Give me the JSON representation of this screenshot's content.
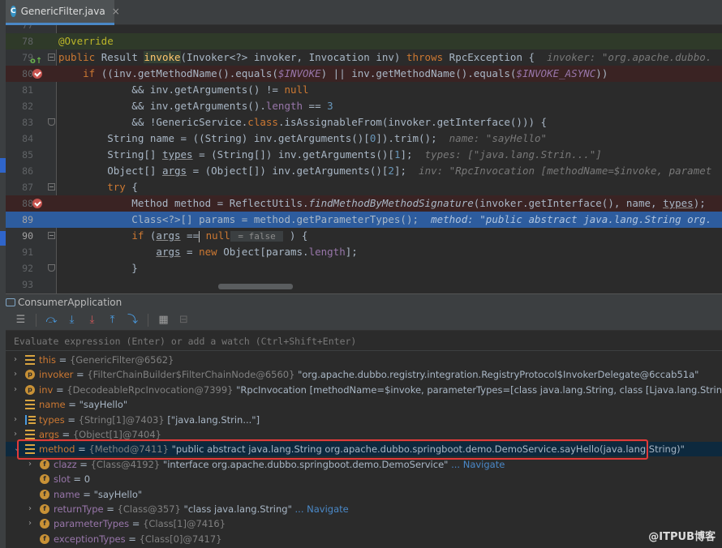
{
  "tab": {
    "icon_letter": "C",
    "label": "GenericFilter.java",
    "close": "×"
  },
  "editor": {
    "lines": [
      {
        "num": "77",
        "html": ""
      },
      {
        "num": "78",
        "html": "<span class='an'>@Override</span>"
      },
      {
        "num": "79",
        "html": "<span class='k'>public </span>Result <span class='fn hl'>invoke</span>(Invoker&lt;?&gt; invoker, Invocation inv) <span class='k'>throws </span>RpcException {  <span class='hint'>invoker: \"org.apache.dubbo.</span>"
      },
      {
        "num": "80",
        "html": "    <span class='k'>if </span>((inv.getMethodName().equals(<span class='cn'>$INVOKE</span>) || inv.getMethodName().equals(<span class='cn'>$INVOKE_ASYNC</span>))"
      },
      {
        "num": "81",
        "html": "            &amp;&amp; inv.getArguments() != <span class='k'>null</span>"
      },
      {
        "num": "82",
        "html": "            &amp;&amp; inv.getArguments().<span class='cn' style='font-style:normal'>length</span> == <span class='nm'>3</span>"
      },
      {
        "num": "83",
        "html": "            &amp;&amp; !GenericService.<span class='k'>class</span>.isAssignableFrom(invoker.getInterface())) {"
      },
      {
        "num": "84",
        "html": "        String name = ((String) inv.getArguments()[<span class='nm'>0</span>]).trim();  <span class='hint'>name: \"sayHello\"</span>"
      },
      {
        "num": "85",
        "html": "        String[] <span class='ul'>types</span> = (String[]) inv.getArguments()[<span class='nm'>1</span>];  <span class='hint'>types: [\"java.lang.Strin...\"]</span>"
      },
      {
        "num": "86",
        "html": "        Object[] <span class='ul'>args</span> = (Object[]) inv.getArguments()[<span class='nm'>2</span>];  <span class='hint'>inv: \"RpcInvocation [methodName=$invoke, paramet</span>"
      },
      {
        "num": "87",
        "html": "        <span class='k'>try </span>{"
      },
      {
        "num": "88",
        "html": "            Method method = ReflectUtils.<span class='it'>findMethodByMethodSignature</span>(invoker.getInterface(), name, <span class='ul'>types</span>);"
      },
      {
        "num": "89",
        "html": "            Class&lt;?&gt;[] params = method.getParameterTypes();  <span class='hint' style='color:#b0c4de'>method: \"public abstract java.lang.String org.</span>"
      },
      {
        "num": "90",
        "html": "            <span class='k'>if </span>(<span class='ul'>args</span> ==<span class='caret'></span> <span class='k'>null</span><span class='ihint'> = false </span> ) {"
      },
      {
        "num": "91",
        "html": "                <span class='ul'>args</span> = <span class='k'>new </span>Object[params.<span class='cn' style='font-style:normal'>length</span>];"
      },
      {
        "num": "92",
        "html": "            }"
      },
      {
        "num": "93",
        "html": ""
      }
    ]
  },
  "debug": {
    "app_label": "ConsumerApplication",
    "eval_placeholder": "Evaluate expression (Enter) or add a watch (Ctrl+Shift+Enter)"
  },
  "variables": [
    {
      "name": "this",
      "type": "{GenericFilter@6562}",
      "value": ""
    },
    {
      "name": "invoker",
      "type": "{FilterChainBuilder$FilterChainNode@6560}",
      "value": "\"org.apache.dubbo.registry.integration.RegistryProtocol$InvokerDelegate@6ccab51a\""
    },
    {
      "name": "inv",
      "type": "{DecodeableRpcInvocation@7399}",
      "value": "\"RpcInvocation [methodName=$invoke, parameterTypes=[class java.lang.String, class [Ljava.lang.String;, class [Ljava."
    },
    {
      "name": "name",
      "type": "",
      "value": "\"sayHello\""
    },
    {
      "name": "types",
      "type": "{String[1]@7403}",
      "value": "[\"java.lang.Strin...\"]"
    },
    {
      "name": "args",
      "type": "{Object[1]@7404}",
      "value": ""
    },
    {
      "name": "method",
      "type": "{Method@7411}",
      "value": "\"public abstract java.lang.String org.apache.dubbo.springboot.demo.DemoService.sayHello(java.lang.String)\""
    },
    {
      "name": "clazz",
      "type": "{Class@4192}",
      "value": "\"interface org.apache.dubbo.springboot.demo.DemoService\"",
      "nav": "... Navigate"
    },
    {
      "name": "slot",
      "type": "",
      "value": "0"
    },
    {
      "name": "name",
      "type": "",
      "value": "\"sayHello\""
    },
    {
      "name": "returnType",
      "type": "{Class@357}",
      "value": "\"class java.lang.String\"",
      "nav": "... Navigate"
    },
    {
      "name": "parameterTypes",
      "type": "{Class[1]@7416}",
      "value": ""
    },
    {
      "name": "exceptionTypes",
      "type": "{Class[0]@7417}",
      "value": ""
    }
  ],
  "watermark": "@ITPUB博客",
  "colors": {
    "breakpoint": "#c75450",
    "execution_line": "#2d5c9e",
    "highlight_box": "#e03a3a",
    "accent": "#4a88c7"
  }
}
